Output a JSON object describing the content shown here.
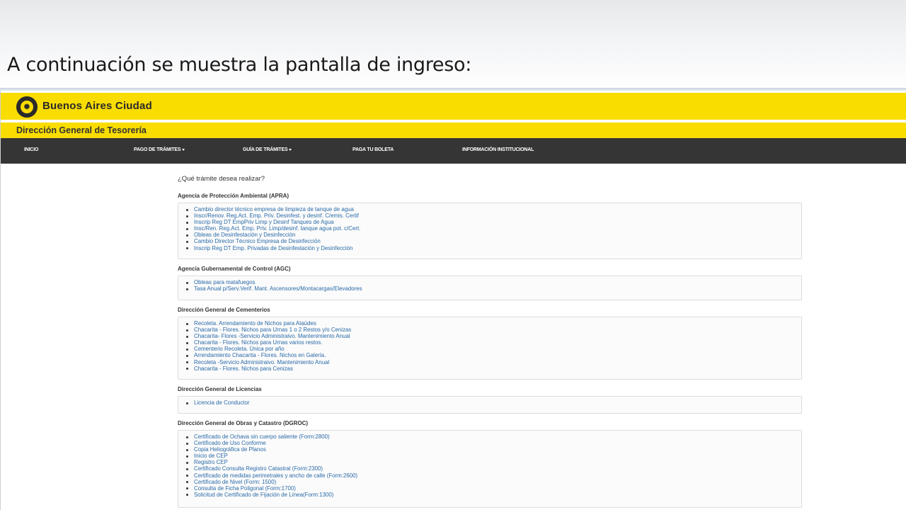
{
  "slide": {
    "caption": "A continuación se muestra la pantalla de ingreso:"
  },
  "header": {
    "brand": "Buenos Aires Ciudad",
    "subtitle": "Dirección General de Tesorería"
  },
  "nav": {
    "items": [
      {
        "label": "INICIO"
      },
      {
        "label": "PAGO DE TRÁMITES"
      },
      {
        "label": "GUÍA DE TRÁMITES"
      },
      {
        "label": "PAGA TU BOLETA"
      },
      {
        "label": "INFORMACIÓN INSTITUCIONAL"
      }
    ]
  },
  "content": {
    "question": "¿Qué trámite desea realizar?",
    "sections": [
      {
        "title": "Agencia de Protección Ambiental (APRA)",
        "links": [
          "Cambio director técnico empresa de limpieza de tanque de agua",
          "Inscr/Renov. Reg.Act. Emp. Priv. Desinfest. y desinf. C/emis. Certif",
          "Inscrip Reg DT EmpPriv Limp y Desinf Tanques de Agua",
          "Insc/Ren. Reg.Act. Emp. Priv. Limp/desinf. tanque agua pot. c/Cert.",
          "Obleas de Desinfestación y Desinfección",
          "Cambio Director Técnico Empresa de Desinfección",
          "Inscrip Reg DT Emp. Privadas de Desinfestación y Desinfección"
        ]
      },
      {
        "title": "Agencia Gubernamental de Control (AGC)",
        "links": [
          "Obleas para matafuegos",
          "Tasa Anual p/Serv.Verif. Mant. Ascensores/Montacargas/Elevadores"
        ]
      },
      {
        "title": "Dirección General de Cementerios",
        "links": [
          "Recoleta. Arrendamiento de Nichos para Ataúdes",
          "Chacarita - Flores. Nichos para Urnas 1 o 2 Restos y/o Cenizas",
          "Chacarita- Flores -Servicio Administraivo. Mantenimiento Anual",
          "Chacarita - Flores. Nichos para Urnas varios restos.",
          "Cementerio Recoleta. Única por año",
          "Arrendamiento Chacarita - Flores. Nichos en Galería.",
          "Recoleta -Servicio Administraivo. Mantenimiento Anual",
          "Chacarita - Flores. Nichos para Cenizas"
        ]
      },
      {
        "title": "Dirección General de Licencias",
        "links": [
          "Licencia de Conductor"
        ]
      },
      {
        "title": "Dirección General de Obras y Catastro (DGROC)",
        "links": [
          "Certificado de Ochava sin cuerpo saliente (Form:2800)",
          "Certificado de Uso Conforme",
          "Copia Heliográfica de Planos",
          "Inicio de CEP",
          "Registro CEP",
          "Certificado Consulta Registro Catastral (Form:2300)",
          "Certificado de medidas perimetrales y ancho de calle (Form:2600)",
          "Certificado de Nivel (Form: 1500)",
          "Consulta de Ficha Poligonal (Form:1700)",
          "Solicitud de Certificado de Fijación de Línea(Form:1300)"
        ]
      }
    ]
  },
  "colors": {
    "header_yellow": "#f9dc00",
    "nav_dark": "#353535",
    "link_blue": "#2a6aa8"
  }
}
